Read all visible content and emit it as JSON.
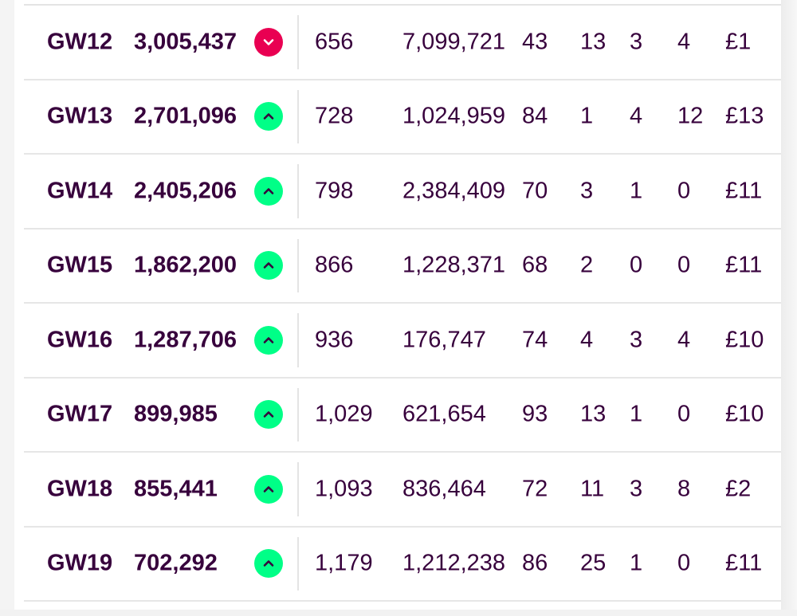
{
  "colors": {
    "text": "#37003c",
    "rise": "#00ff87",
    "fall": "#e90052"
  },
  "rows": [
    {
      "gw": "GW12",
      "overall_rank": "3,005,437",
      "movement": "down",
      "movement_icon": "chevron-down-icon",
      "gw_points": "656",
      "gw_rank": "7,099,721",
      "c1": "43",
      "c2": "13",
      "c3": "3",
      "c4": "4",
      "value": "£1"
    },
    {
      "gw": "GW13",
      "overall_rank": "2,701,096",
      "movement": "up",
      "movement_icon": "chevron-up-icon",
      "gw_points": "728",
      "gw_rank": "1,024,959",
      "c1": "84",
      "c2": "1",
      "c3": "4",
      "c4": "12",
      "value": "£13"
    },
    {
      "gw": "GW14",
      "overall_rank": "2,405,206",
      "movement": "up",
      "movement_icon": "chevron-up-icon",
      "gw_points": "798",
      "gw_rank": "2,384,409",
      "c1": "70",
      "c2": "3",
      "c3": "1",
      "c4": "0",
      "value": "£11"
    },
    {
      "gw": "GW15",
      "overall_rank": "1,862,200",
      "movement": "up",
      "movement_icon": "chevron-up-icon",
      "gw_points": "866",
      "gw_rank": "1,228,371",
      "c1": "68",
      "c2": "2",
      "c3": "0",
      "c4": "0",
      "value": "£11"
    },
    {
      "gw": "GW16",
      "overall_rank": "1,287,706",
      "movement": "up",
      "movement_icon": "chevron-up-icon",
      "gw_points": "936",
      "gw_rank": "176,747",
      "c1": "74",
      "c2": "4",
      "c3": "3",
      "c4": "4",
      "value": "£10"
    },
    {
      "gw": "GW17",
      "overall_rank": "899,985",
      "movement": "up",
      "movement_icon": "chevron-up-icon",
      "gw_points": "1,029",
      "gw_rank": "621,654",
      "c1": "93",
      "c2": "13",
      "c3": "1",
      "c4": "0",
      "value": "£10"
    },
    {
      "gw": "GW18",
      "overall_rank": "855,441",
      "movement": "up",
      "movement_icon": "chevron-up-icon",
      "gw_points": "1,093",
      "gw_rank": "836,464",
      "c1": "72",
      "c2": "11",
      "c3": "3",
      "c4": "8",
      "value": "£2"
    },
    {
      "gw": "GW19",
      "overall_rank": "702,292",
      "movement": "up",
      "movement_icon": "chevron-up-icon",
      "gw_points": "1,179",
      "gw_rank": "1,212,238",
      "c1": "86",
      "c2": "25",
      "c3": "1",
      "c4": "0",
      "value": "£11"
    }
  ]
}
